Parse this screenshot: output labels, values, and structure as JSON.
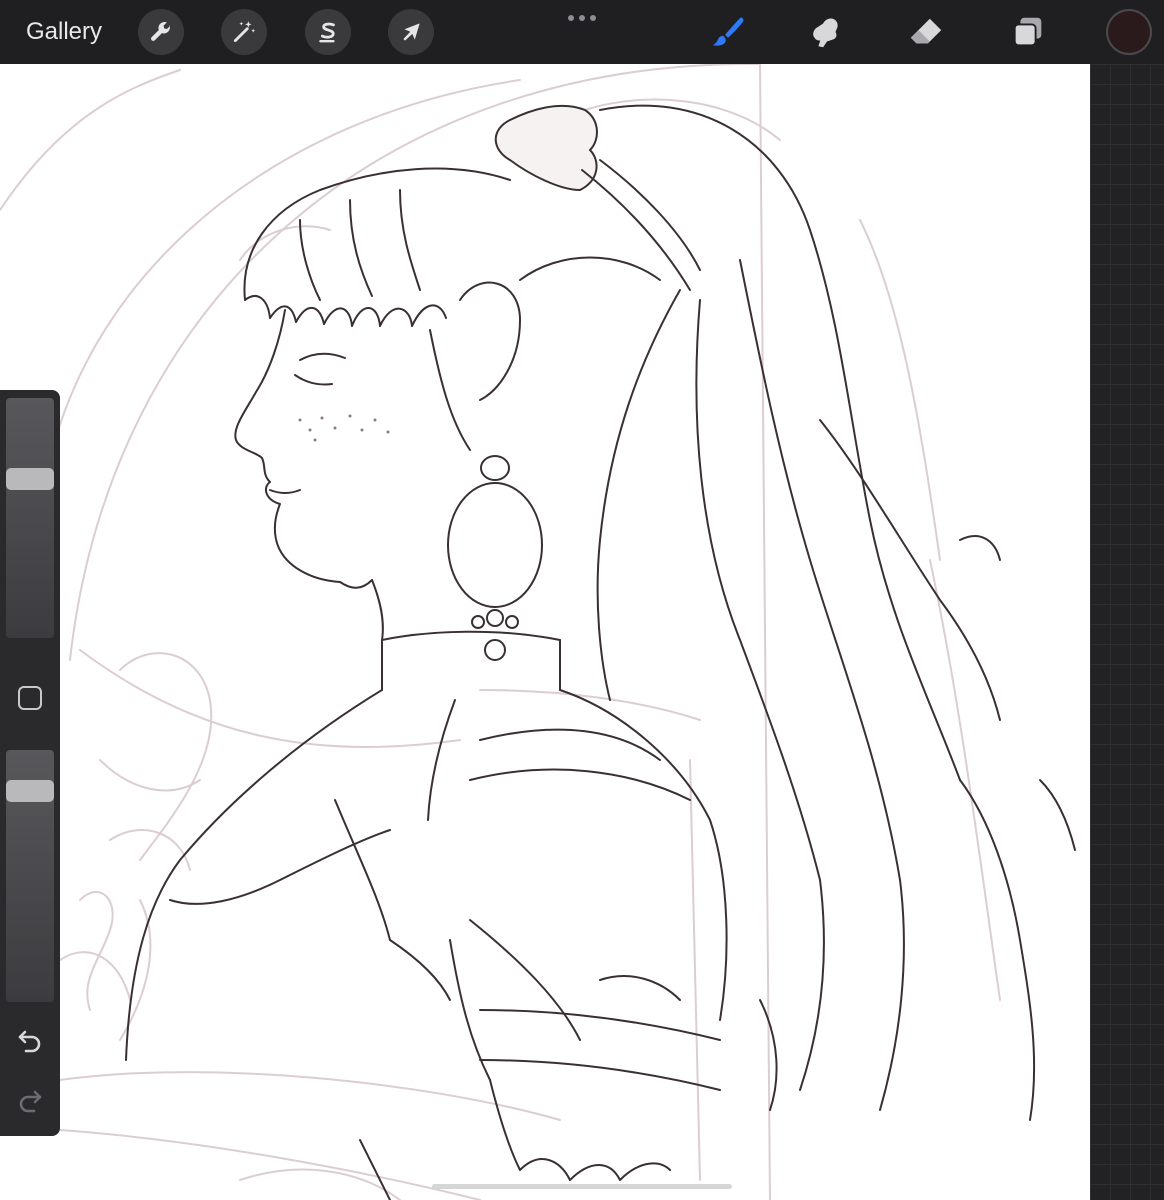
{
  "topbar": {
    "gallery_label": "Gallery",
    "left_tools": [
      {
        "name": "actions",
        "icon": "wrench-icon"
      },
      {
        "name": "adjustments",
        "icon": "magic-wand-icon"
      },
      {
        "name": "selection",
        "icon": "selection-s-icon"
      },
      {
        "name": "transform",
        "icon": "arrow-cursor-icon"
      }
    ],
    "more_icon": "more-dots-icon",
    "right_tools": [
      {
        "name": "brush",
        "icon": "brush-icon",
        "active": true
      },
      {
        "name": "smudge",
        "icon": "smudge-icon",
        "active": false
      },
      {
        "name": "eraser",
        "icon": "eraser-icon",
        "active": false
      },
      {
        "name": "layers",
        "icon": "layers-icon",
        "active": false
      }
    ],
    "current_color": "#2a1a1b"
  },
  "sidebar": {
    "brush_size_level": 0.68,
    "brush_opacity_level": 0.87,
    "undo_icon": "undo-icon",
    "redo_icon": "redo-icon",
    "modify_icon": "eyedropper-square-icon"
  },
  "colors": {
    "ui_background": "#1f1f21",
    "active_tool": "#2f7bf5",
    "icon_inactive": "#d8d8da",
    "canvas": "#ffffff",
    "sketch_line": "#3a3032",
    "underdrawing": "#d9c9cc"
  }
}
